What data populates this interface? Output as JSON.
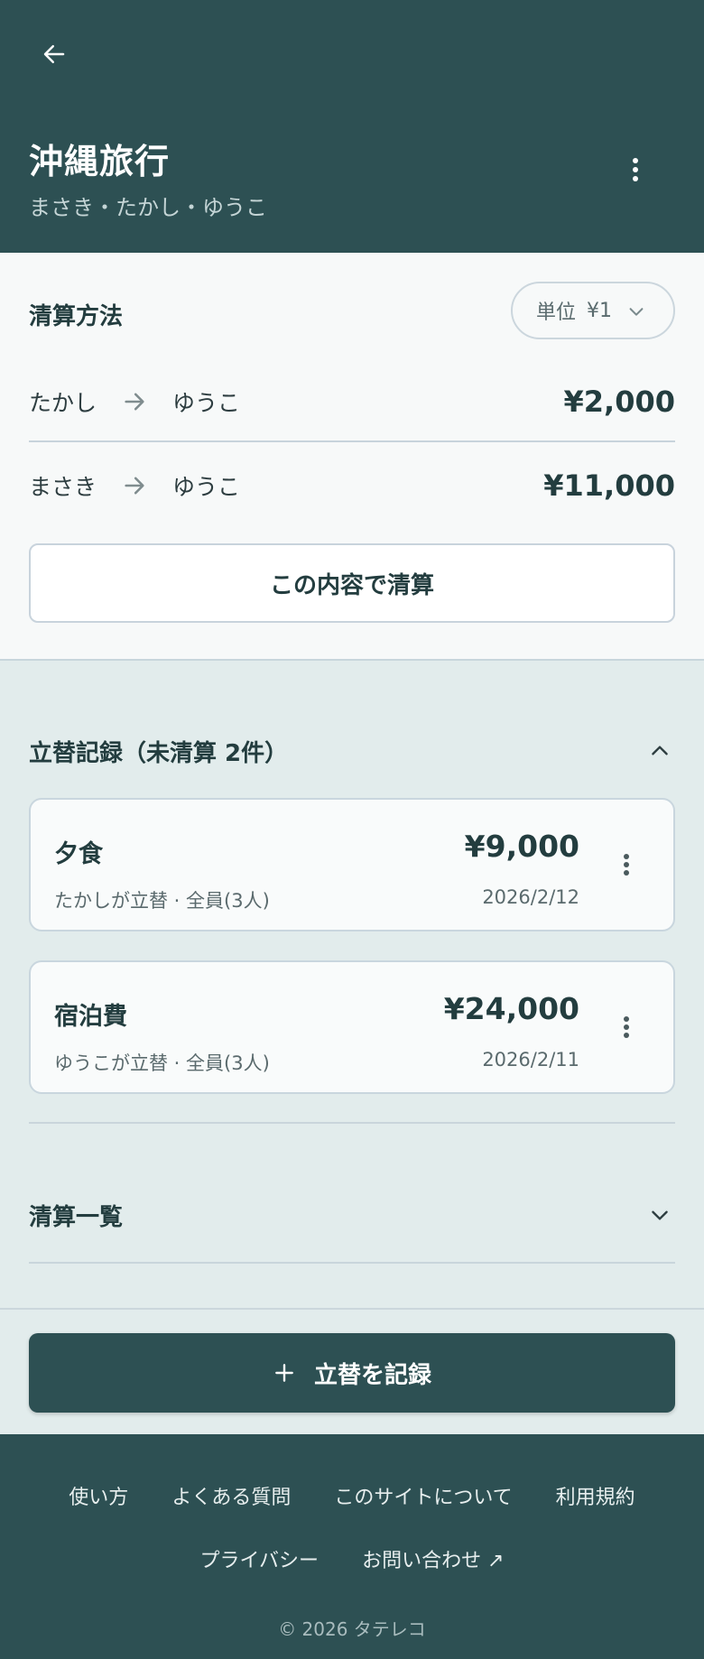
{
  "header": {
    "title": "沖縄旅行",
    "members": "まさき・たかし・ゆうこ"
  },
  "settlement": {
    "title": "清算方法",
    "unit_label": "単位",
    "unit_value": "¥1",
    "transfers": [
      {
        "from": "たかし",
        "to": "ゆうこ",
        "amount": "¥2,000"
      },
      {
        "from": "まさき",
        "to": "ゆうこ",
        "amount": "¥11,000"
      }
    ],
    "confirm_label": "この内容で清算"
  },
  "records": {
    "title": "立替記録（未清算 2件）",
    "items": [
      {
        "name": "夕食",
        "detail": "たかしが立替 · 全員(3人)",
        "amount": "¥9,000",
        "date": "2026/2/12"
      },
      {
        "name": "宿泊費",
        "detail": "ゆうこが立替 · 全員(3人)",
        "amount": "¥24,000",
        "date": "2026/2/11"
      }
    ]
  },
  "settlement_list": {
    "title": "清算一覧"
  },
  "add_button": {
    "label": "立替を記録"
  },
  "footer": {
    "links": [
      "使い方",
      "よくある質問",
      "このサイトについて",
      "利用規約"
    ],
    "links2": [
      "プライバシー",
      "お問い合わせ ↗"
    ],
    "copyright": "© 2026 タテレコ"
  },
  "colors": {
    "primary": "#2d5053",
    "background": "#e2ecec",
    "card": "#f9fbfb"
  }
}
